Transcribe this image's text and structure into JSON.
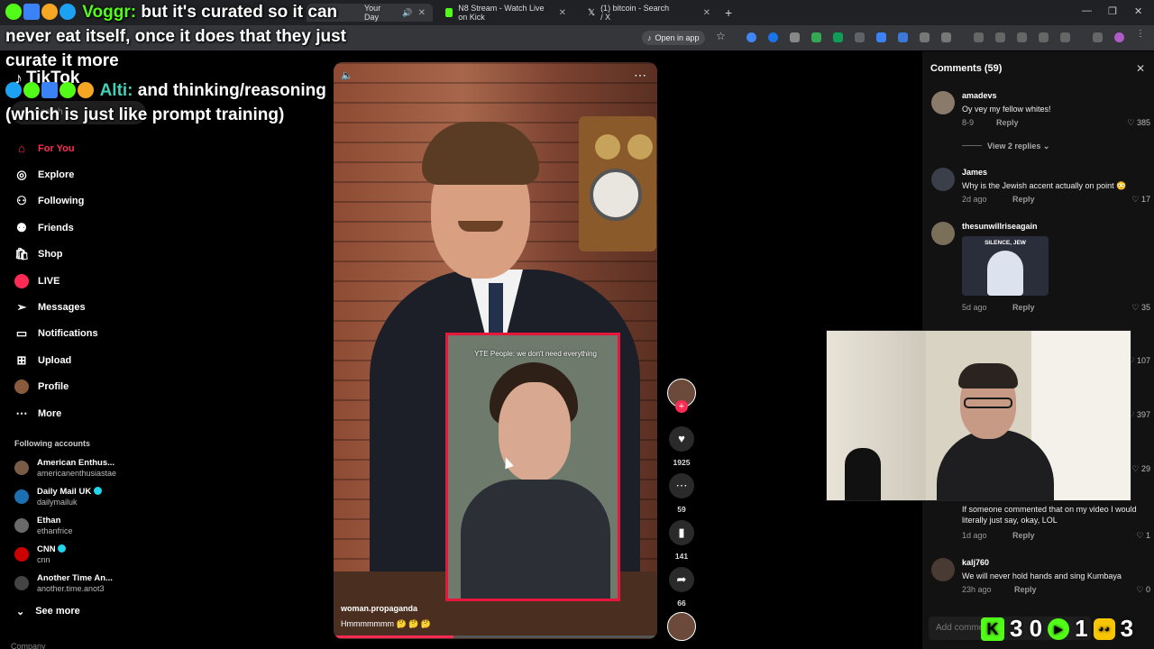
{
  "browser": {
    "tabs": [
      {
        "label": "Your Day",
        "active": true
      },
      {
        "label": "N8 Stream - Watch Live on Kick",
        "active": false
      },
      {
        "label": "(1) bitcoin - Search / X",
        "active": false
      }
    ],
    "open_in_app": "Open in app"
  },
  "chat": {
    "line1_user": "Voggr:",
    "line1_text": "but it's curated so it can never eat itself, once it does that they just curate it more",
    "line2_user": "Alti:",
    "line2_text": "and thinking/reasoning (which is just like prompt training)"
  },
  "sidebar": {
    "logo": "TikTok",
    "search_placeholder": "Search",
    "nav": [
      {
        "label": "For You",
        "icon": "home-icon"
      },
      {
        "label": "Explore",
        "icon": "compass-icon"
      },
      {
        "label": "Following",
        "icon": "following-icon"
      },
      {
        "label": "Friends",
        "icon": "friends-icon"
      },
      {
        "label": "Shop",
        "icon": "shop-icon"
      },
      {
        "label": "LIVE",
        "icon": "live-icon"
      },
      {
        "label": "Messages",
        "icon": "messages-icon"
      },
      {
        "label": "Notifications",
        "icon": "bell-icon"
      },
      {
        "label": "Upload",
        "icon": "upload-icon"
      },
      {
        "label": "Profile",
        "icon": "profile-icon"
      },
      {
        "label": "More",
        "icon": "more-icon"
      }
    ],
    "following_title": "Following accounts",
    "accounts": [
      {
        "name": "American Enthus...",
        "handle": "americanenthusiastae"
      },
      {
        "name": "Daily Mail UK",
        "handle": "dailymailuk"
      },
      {
        "name": "Ethan",
        "handle": "ethanfrice"
      },
      {
        "name": "CNN",
        "handle": "cnn"
      },
      {
        "name": "Another Time An...",
        "handle": "another.time.anot3"
      }
    ],
    "see_more": "See more",
    "company": "Company"
  },
  "video": {
    "inset_caption": "YTE People: we don't need everything",
    "author": "woman.propaganda",
    "caption": "Hmmmmmmm 🤔 🤔 🤔",
    "progress": 0.37
  },
  "actions": {
    "likes": "1925",
    "comments": "59",
    "saves": "141",
    "shares": "66"
  },
  "comments": {
    "title": "Comments (59)",
    "items": [
      {
        "user": "amadevs",
        "text": "Oy vey my fellow whites!",
        "time": "8-9",
        "reply": "Reply",
        "likes": "385"
      },
      {
        "user": "James",
        "text": "Why is the Jewish accent actually on point 😳",
        "time": "2d ago",
        "reply": "Reply",
        "likes": "17"
      },
      {
        "user": "thesunwillriseagain",
        "text": "",
        "time": "5d ago",
        "reply": "Reply",
        "likes": "35"
      },
      {
        "user": "",
        "text": "If someone commented that on my video I would literally just say, okay, LOL",
        "time": "1d ago",
        "reply": "Reply",
        "likes": "1"
      },
      {
        "user": "kalj760",
        "text": "We will never hold hands and sing Kumbaya",
        "time": "23h ago",
        "reply": "Reply",
        "likes": "0"
      }
    ],
    "view_replies": "View 2 replies",
    "silence_caption": "SILENCE, JEW",
    "side_likes": [
      "107",
      "397",
      "29"
    ],
    "add_placeholder": "Add comment..."
  },
  "kick_stats": {
    "viewers": "3 0",
    "followers": "1",
    "subs": "3"
  }
}
